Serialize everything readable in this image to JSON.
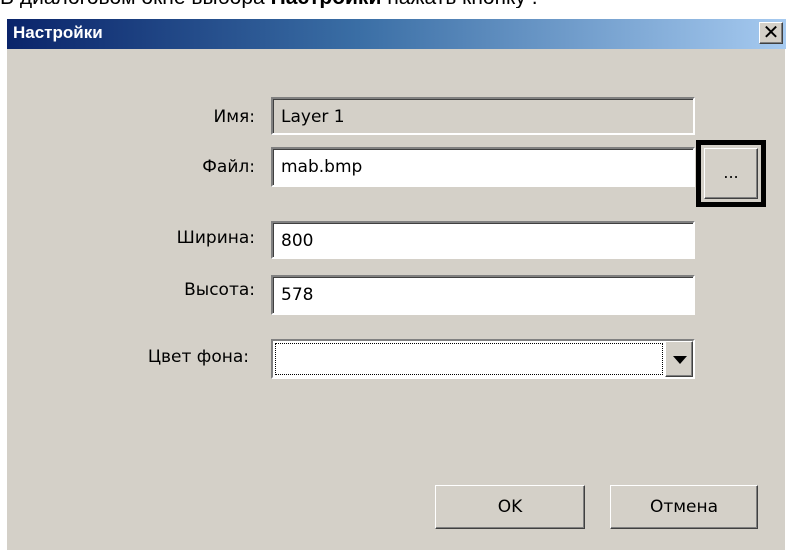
{
  "instruction": {
    "before": "В диалоговом окне выбора ",
    "bold": "Настройки",
    "after": " нажать кнопку ",
    "trailing": "."
  },
  "dialog": {
    "title": "Настройки",
    "close_label": "✕",
    "fields": {
      "name": {
        "label": "Имя:",
        "value": "Layer 1"
      },
      "file": {
        "label": "Файл:",
        "value": "mab.bmp",
        "browse_label": "..."
      },
      "width": {
        "label": "Ширина:",
        "value": "800"
      },
      "height": {
        "label": "Высота:",
        "value": "578"
      },
      "bgcolor": {
        "label": "Цвет фона:",
        "value": ""
      }
    },
    "buttons": {
      "ok": "OK",
      "cancel": "Отмена"
    }
  },
  "colors": {
    "dialog_bg": "#d4d0c8",
    "titlebar_start": "#0a246a",
    "titlebar_end": "#a6caf0",
    "highlight_frame": "#000000"
  }
}
